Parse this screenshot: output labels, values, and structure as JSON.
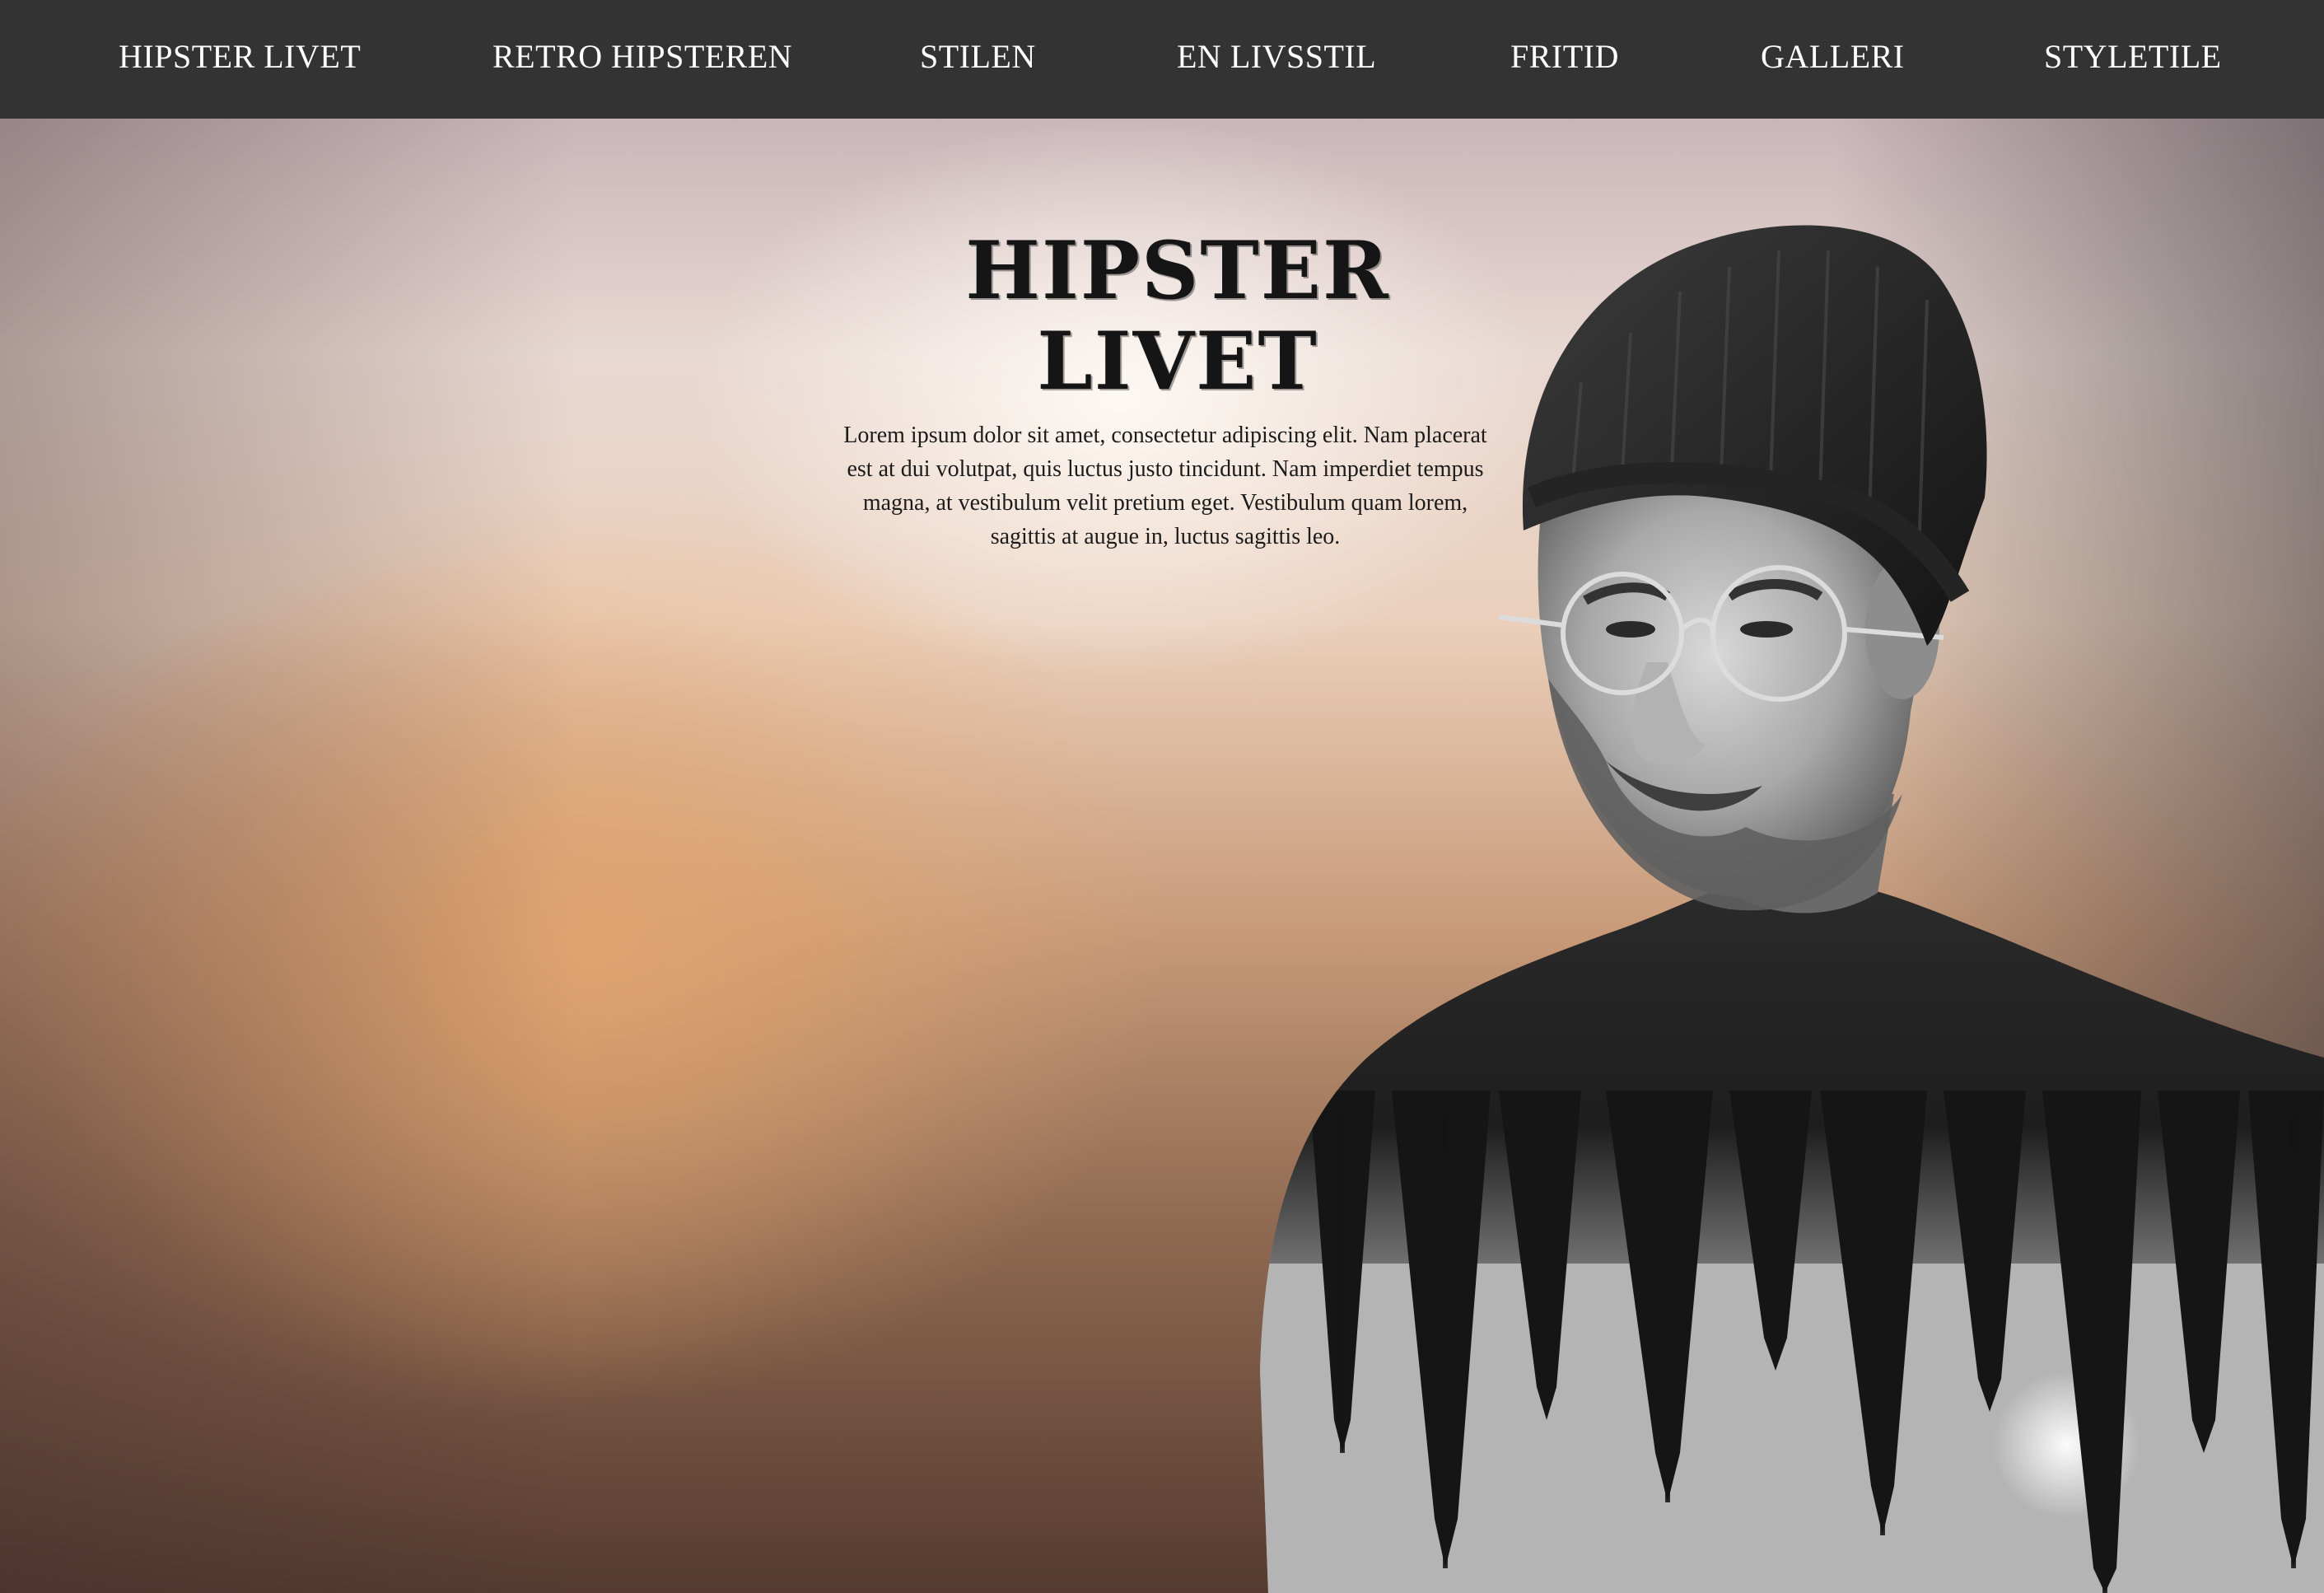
{
  "nav": {
    "items": [
      "HIPSTER LIVET",
      "RETRO HIPSTEREN",
      "STILEN",
      "EN LIVSSTIL",
      "FRITID",
      "GALLERI",
      "STYLETILE"
    ]
  },
  "hero": {
    "title": "HIPSTER LIVET",
    "text": "Lorem ipsum dolor sit amet, consectetur adipiscing elit. Nam placerat est at dui volutpat, quis luctus justo tincidunt. Nam imperdiet tempus magna, at vestibulum velit pretium eget. Vestibulum quam lorem, sagittis at augue in, luctus sagittis leo."
  },
  "colors": {
    "navbar": "#333333",
    "nav_text": "#ffffff",
    "title_text": "#151515"
  },
  "icons": {
    "portrait": "bearded-man-beanie-glasses-forest-double-exposure"
  }
}
